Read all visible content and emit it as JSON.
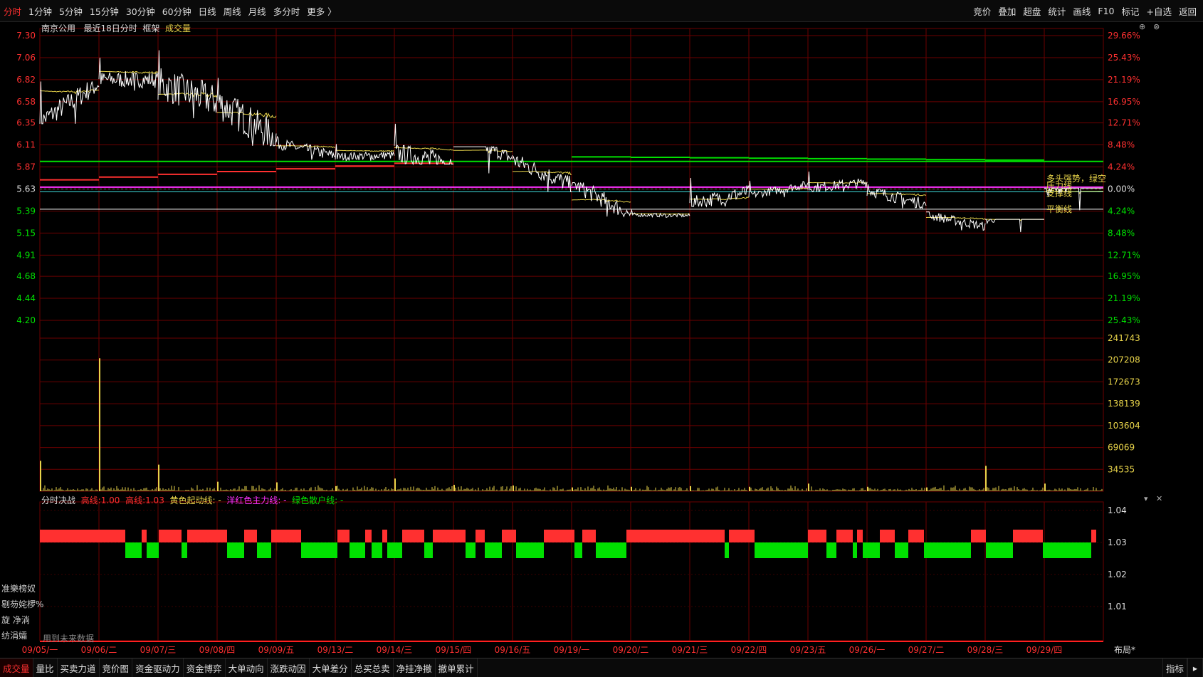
{
  "colors": {
    "up": "#ff3030",
    "down": "#00e000",
    "grid": "#6b0000",
    "price": "#ffffff",
    "avg": "#e8d44a",
    "volume": "#e8d44a",
    "magenta": "#ff30ff",
    "cyan": "#3fe0e0"
  },
  "toolbar": {
    "periods": [
      "分时",
      "1分钟",
      "5分钟",
      "15分钟",
      "30分钟",
      "60分钟",
      "日线",
      "周线",
      "月线",
      "多分时",
      "更多 〉"
    ],
    "active_period": "分时",
    "right": [
      "竞价",
      "叠加",
      "超盘",
      "统计",
      "画线",
      "F10",
      "标记",
      "+自选",
      "返回"
    ]
  },
  "price_header": {
    "stock": "南京公用",
    "range": "最近18日分时",
    "frame": "框架",
    "indicator": "成交量"
  },
  "price_axis": [
    "7.30",
    "7.06",
    "6.82",
    "6.58",
    "6.35",
    "6.11",
    "5.87",
    "5.63",
    "5.39",
    "5.15",
    "4.91",
    "4.68",
    "4.44",
    "4.20"
  ],
  "pct_axis": [
    "29.66%",
    "25.43%",
    "21.19%",
    "16.95%",
    "12.71%",
    "8.48%",
    "4.24%",
    "0.00%",
    "4.24%",
    "8.48%",
    "12.71%",
    "16.95%",
    "21.19%",
    "25.43%"
  ],
  "volume_axis": [
    "241743",
    "207208",
    "172673",
    "138139",
    "103604",
    "69069",
    "34535"
  ],
  "line_labels": {
    "text1": "多头强势，绿空",
    "pressure": "压力线",
    "support": "支撑线",
    "balance": "平衡线"
  },
  "indicator_header": {
    "name": "分时决战",
    "low_label": "高线:",
    "low_value": "1.00",
    "high_label": "高线:",
    "high_value": "1.03",
    "yellow": "黄色起动线: -",
    "magenta": "洋红色主力线: -",
    "green": "绿色散户线: -"
  },
  "indicator_axis": [
    "1.04",
    "1.03",
    "1.02",
    "1.01"
  ],
  "side_labels": [
    "准樂榜奴",
    "剔芴姹椤%",
    "旋  净淌",
    "  纺涓孀"
  ],
  "future_note": "用到未来数据",
  "dates": [
    "09/05/一",
    "09/06/二",
    "09/07/三",
    "09/08/四",
    "09/09/五",
    "09/13/二",
    "09/14/三",
    "09/15/四",
    "09/16/五",
    "09/19/一",
    "09/20/二",
    "09/21/三",
    "09/22/四",
    "09/23/五",
    "09/26/一",
    "09/27/二",
    "09/28/三",
    "09/29/四"
  ],
  "bottom_tabs": [
    "成交量",
    "量比",
    "买卖力道",
    "竞价图",
    "资金驱动力",
    "资金博弈",
    "大单动向",
    "涨跌动因",
    "大单差分",
    "总买总卖",
    "净挂净撤",
    "撤单累计"
  ],
  "active_bottom_tab": "成交量",
  "bottom_right": [
    "指标"
  ],
  "layout_btn": "布局*",
  "chart_data": {
    "type": "line",
    "title": "南京公用 最近18日分时",
    "categories": [
      "09/05",
      "09/06",
      "09/07",
      "09/08",
      "09/09",
      "09/13",
      "09/14",
      "09/15",
      "09/16",
      "09/19",
      "09/20",
      "09/21",
      "09/22",
      "09/23",
      "09/26",
      "09/27",
      "09/28",
      "09/29"
    ],
    "price_open": [
      6.36,
      6.82,
      6.78,
      6.58,
      6.13,
      5.98,
      6.02,
      6.24,
      5.95,
      5.7,
      5.35,
      5.47,
      5.56,
      5.64,
      5.62,
      5.35,
      5.28,
      5.6
    ],
    "price_close": [
      6.78,
      6.82,
      6.58,
      6.18,
      5.99,
      6.0,
      5.92,
      5.96,
      5.67,
      5.35,
      5.34,
      5.6,
      5.68,
      5.7,
      5.46,
      5.22,
      5.4,
      5.76
    ],
    "price_high": [
      6.8,
      7.06,
      7.14,
      6.84,
      6.2,
      6.12,
      6.34,
      6.09,
      5.98,
      5.7,
      5.4,
      5.75,
      5.72,
      5.82,
      5.68,
      5.38,
      5.3,
      5.64
    ],
    "price_low": [
      6.34,
      6.7,
      6.4,
      6.1,
      5.95,
      5.94,
      5.9,
      5.8,
      5.6,
      5.33,
      5.32,
      5.44,
      5.54,
      5.6,
      5.42,
      5.18,
      5.16,
      5.4
    ],
    "avg_price": [
      6.7,
      6.91,
      6.66,
      6.46,
      6.1,
      6.05,
      6.08,
      6.05,
      5.82,
      5.51,
      5.36,
      5.52,
      5.63,
      5.7,
      5.58,
      5.32,
      5.3,
      5.6
    ],
    "volume_open_spike": [
      48000,
      210000,
      42000,
      15000,
      14000,
      8000,
      20000,
      10000,
      9000,
      6000,
      7000,
      8000,
      7000,
      12000,
      7000,
      6000,
      40000,
      12000
    ],
    "ylim_price": [
      4.2,
      7.3
    ],
    "ylim_volume": [
      0,
      241743
    ],
    "pressure_line": 5.65,
    "support_line": 5.6,
    "balance_line": 5.41,
    "indicator_bars": "alternating red(1.03) / green(1.00) minute bars"
  }
}
